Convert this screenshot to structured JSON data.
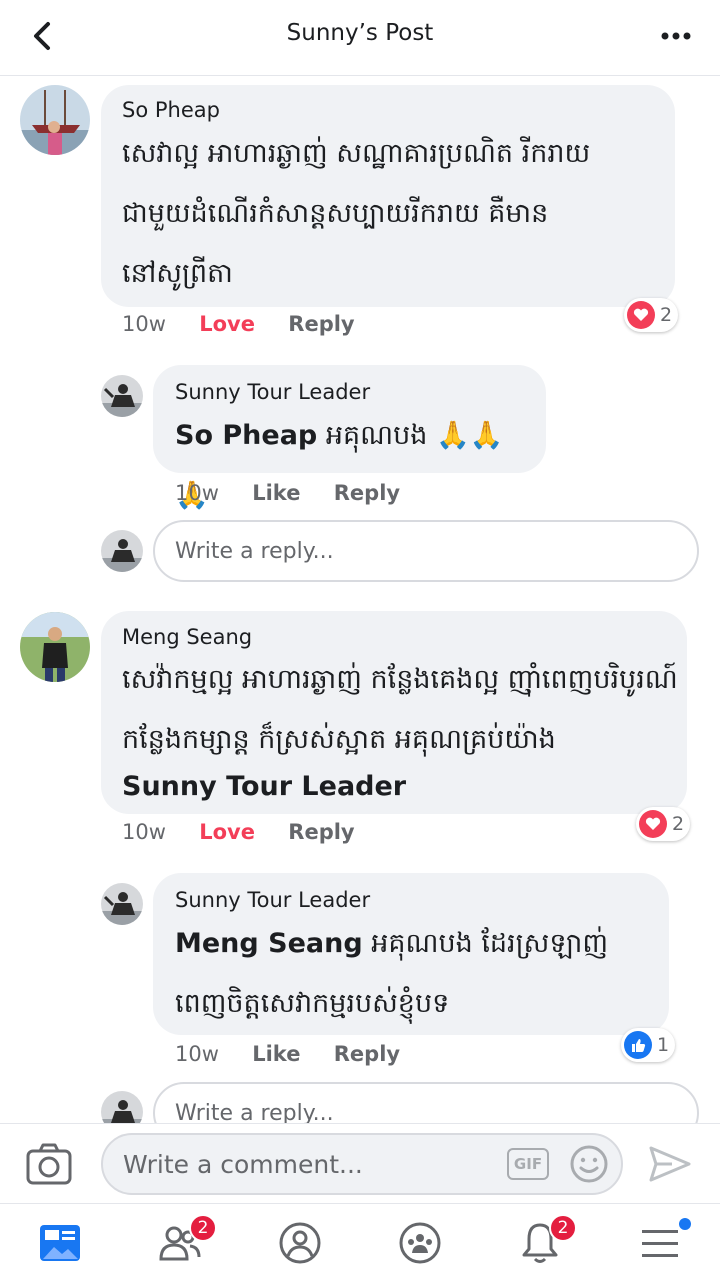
{
  "header": {
    "title": "Sunny’s Post"
  },
  "comments": [
    {
      "author": "So Pheap",
      "text": "សេវាល្អ អាហារឆ្ងាញ់ សណ្ឋាគារប្រណិត រីករាយ ជាមួយដំណើរកំសាន្តសប្បាយរីករាយ គឺមាននៅសូព្រីតា",
      "time": "10w",
      "reaction_label": "Love",
      "reply_label": "Reply",
      "reactions": {
        "type": "heart",
        "count": "2"
      }
    },
    {
      "author": "Sunny Tour Leader",
      "tag": "So Pheap",
      "text": "អគុណបង 🙏🙏🙏",
      "time": "10w",
      "reaction_label": "Like",
      "reply_label": "Reply"
    },
    {
      "author": "Meng Seang",
      "text": "សេវ៉ាកម្មល្អ  អាហារឆ្ងាញ់ កន្លែងគេងល្អ ញ៉ាំពេញបរិបូរណ៍ កន្លែងកម្សាន្ត ក៏ស្រស់ស្អាត អគុណគ្រប់យ៉ាង",
      "tag_end": "Sunny Tour Leader",
      "time": "10w",
      "reaction_label": "Love",
      "reply_label": "Reply",
      "reactions": {
        "type": "heart",
        "count": "2"
      }
    },
    {
      "author": "Sunny Tour Leader",
      "tag": "Meng Seang",
      "text": "អគុណបង ដែរស្រឡាញ់ពេញចិត្តសេវាកម្មរបស់ខ្ញុំបទ",
      "time": "10w",
      "reaction_label": "Like",
      "reply_label": "Reply",
      "reactions": {
        "type": "like",
        "count": "1"
      }
    }
  ],
  "reply_input": {
    "placeholder": "Write a reply..."
  },
  "composer": {
    "placeholder": "Write a comment...",
    "gif_label": "GIF"
  },
  "tabbar": {
    "friends_badge": "2",
    "notifications_badge": "2"
  },
  "colors": {
    "accent": "#1877f2",
    "love": "#f33e58",
    "badge": "#e41e3f"
  }
}
